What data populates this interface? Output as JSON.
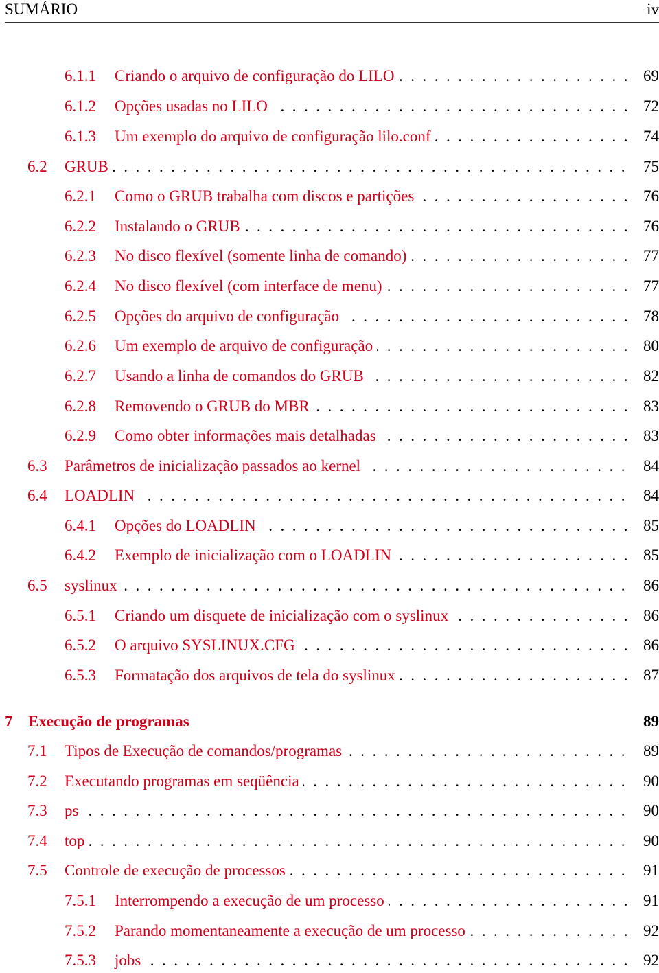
{
  "header": {
    "title": "SUMÁRIO",
    "page_number": "iv"
  },
  "colors": {
    "link": "#d0001a",
    "text": "#000000"
  },
  "toc": [
    {
      "level": 2,
      "number": "6.1.1",
      "title": "Criando o arquivo de configuração do LILO",
      "page": "69"
    },
    {
      "level": 2,
      "number": "6.1.2",
      "title": "Opções usadas no LILO",
      "page": "72"
    },
    {
      "level": 2,
      "number": "6.1.3",
      "title": "Um exemplo do arquivo de configuração lilo.conf",
      "page": "74"
    },
    {
      "level": 1,
      "number": "6.2",
      "title": "GRUB",
      "page": "75"
    },
    {
      "level": 2,
      "number": "6.2.1",
      "title": "Como o GRUB trabalha com discos e partições",
      "page": "76"
    },
    {
      "level": 2,
      "number": "6.2.2",
      "title": "Instalando o GRUB",
      "page": "76"
    },
    {
      "level": 2,
      "number": "6.2.3",
      "title": "No disco flexível (somente linha de comando)",
      "page": "77"
    },
    {
      "level": 2,
      "number": "6.2.4",
      "title": "No disco flexível (com interface de menu)",
      "page": "77"
    },
    {
      "level": 2,
      "number": "6.2.5",
      "title": "Opções do arquivo de configuração",
      "page": "78"
    },
    {
      "level": 2,
      "number": "6.2.6",
      "title": "Um exemplo de arquivo de configuração",
      "page": "80"
    },
    {
      "level": 2,
      "number": "6.2.7",
      "title": "Usando a linha de comandos do GRUB",
      "page": "82"
    },
    {
      "level": 2,
      "number": "6.2.8",
      "title": "Removendo o GRUB do MBR",
      "page": "83"
    },
    {
      "level": 2,
      "number": "6.2.9",
      "title": "Como obter informações mais detalhadas",
      "page": "83"
    },
    {
      "level": 1,
      "number": "6.3",
      "title": "Parâmetros de inicialização passados ao kernel",
      "page": "84"
    },
    {
      "level": 1,
      "number": "6.4",
      "title": "LOADLIN",
      "page": "84"
    },
    {
      "level": 2,
      "number": "6.4.1",
      "title": "Opções do LOADLIN",
      "page": "85"
    },
    {
      "level": 2,
      "number": "6.4.2",
      "title": "Exemplo de inicialização com o LOADLIN",
      "page": "85"
    },
    {
      "level": 1,
      "number": "6.5",
      "title": "syslinux",
      "page": "86"
    },
    {
      "level": 2,
      "number": "6.5.1",
      "title": "Criando um disquete de inicialização com o syslinux",
      "page": "86"
    },
    {
      "level": 2,
      "number": "6.5.2",
      "title": "O arquivo SYSLINUX.CFG",
      "page": "86"
    },
    {
      "level": 2,
      "number": "6.5.3",
      "title": "Formatação dos arquivos de tela do syslinux",
      "page": "87"
    },
    {
      "level": 0,
      "number": "7",
      "title": "Execução de programas",
      "page": "89"
    },
    {
      "level": 1,
      "number": "7.1",
      "title": "Tipos de Execução de comandos/programas",
      "page": "89"
    },
    {
      "level": 1,
      "number": "7.2",
      "title": "Executando programas em seqüência",
      "page": "90"
    },
    {
      "level": 1,
      "number": "7.3",
      "title": "ps",
      "page": "90"
    },
    {
      "level": 1,
      "number": "7.4",
      "title": "top",
      "page": "90"
    },
    {
      "level": 1,
      "number": "7.5",
      "title": "Controle de execução de processos",
      "page": "91"
    },
    {
      "level": 2,
      "number": "7.5.1",
      "title": "Interrompendo a execução de um processo",
      "page": "91"
    },
    {
      "level": 2,
      "number": "7.5.2",
      "title": "Parando momentaneamente a execução de um processo",
      "page": "92"
    },
    {
      "level": 2,
      "number": "7.5.3",
      "title": "jobs",
      "page": "92"
    }
  ]
}
